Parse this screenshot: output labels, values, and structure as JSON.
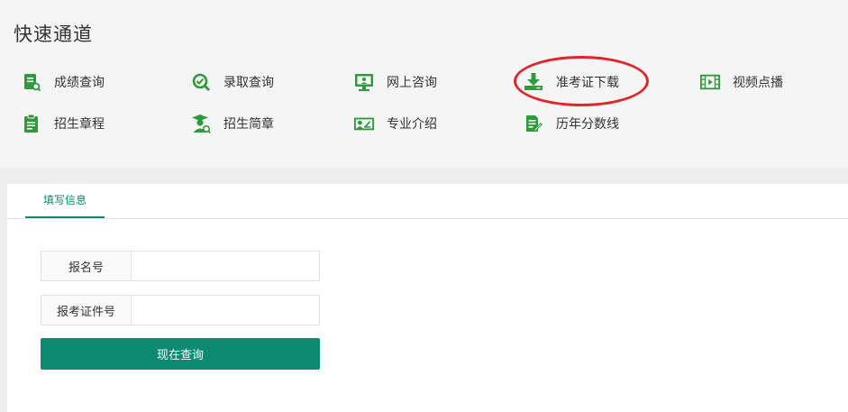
{
  "quick_access": {
    "title": "快速通道",
    "items": [
      {
        "label": "成绩查询",
        "icon": "score-search-icon"
      },
      {
        "label": "录取查询",
        "icon": "search-check-icon"
      },
      {
        "label": "网上咨询",
        "icon": "monitor-chat-icon"
      },
      {
        "label": "准考证下载",
        "icon": "download-icon"
      },
      {
        "label": "视频点播",
        "icon": "video-icon"
      },
      {
        "label": "招生章程",
        "icon": "document-icon"
      },
      {
        "label": "招生简章",
        "icon": "graduate-icon"
      },
      {
        "label": "专业介绍",
        "icon": "id-card-icon"
      },
      {
        "label": "历年分数线",
        "icon": "note-edit-icon"
      }
    ]
  },
  "form": {
    "tab_label": "填写信息",
    "fields": [
      {
        "label": "报名号",
        "value": "",
        "placeholder": ""
      },
      {
        "label": "报考证件号",
        "value": "",
        "placeholder": ""
      }
    ],
    "submit_label": "现在查询"
  },
  "colors": {
    "icon_green": "#2e9a3c",
    "accent": "#0e8a72",
    "highlight": "#e0262a"
  }
}
